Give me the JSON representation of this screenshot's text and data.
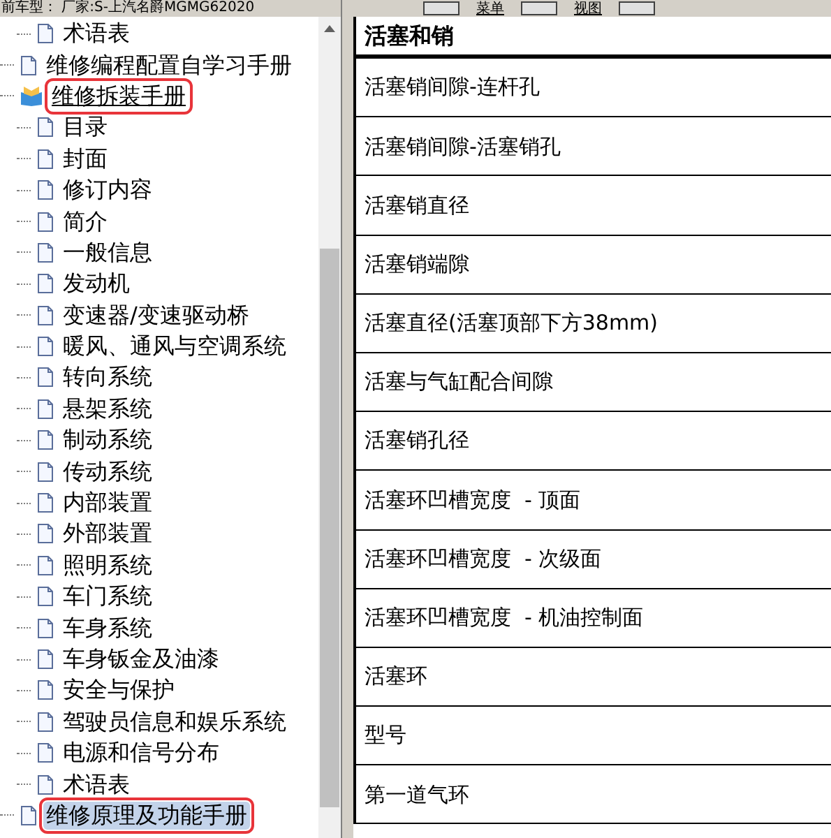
{
  "status_text": "前车型： 厂家:S-上汽名爵MGMG62020",
  "toolbar": {
    "buttons": [
      "菜单",
      "视图"
    ]
  },
  "tree": {
    "leading_items": [
      {
        "label": "术语表",
        "selected": false
      }
    ],
    "books": [
      {
        "label": "维修编程配置自学习手册",
        "expanded": false,
        "selected": false,
        "underlined": false,
        "annotated": false
      },
      {
        "label": "维修拆装手册",
        "expanded": true,
        "selected": false,
        "underlined": true,
        "annotated": true,
        "children": [
          {
            "label": "目录",
            "selected": false
          },
          {
            "label": "封面",
            "selected": false
          },
          {
            "label": "修订内容",
            "selected": false
          },
          {
            "label": "简介",
            "selected": false
          },
          {
            "label": "一般信息",
            "selected": false
          },
          {
            "label": "发动机",
            "selected": false
          },
          {
            "label": "变速器/变速驱动桥",
            "selected": false
          },
          {
            "label": "暖风、通风与空调系统",
            "selected": false
          },
          {
            "label": "转向系统",
            "selected": false
          },
          {
            "label": "悬架系统",
            "selected": false
          },
          {
            "label": "制动系统",
            "selected": false
          },
          {
            "label": "传动系统",
            "selected": false
          },
          {
            "label": "内部装置",
            "selected": false
          },
          {
            "label": "外部装置",
            "selected": false
          },
          {
            "label": "照明系统",
            "selected": false
          },
          {
            "label": "车门系统",
            "selected": false
          },
          {
            "label": "车身系统",
            "selected": false
          },
          {
            "label": "车身钣金及油漆",
            "selected": false
          },
          {
            "label": "安全与保护",
            "selected": false
          },
          {
            "label": "驾驶员信息和娱乐系统",
            "selected": false
          },
          {
            "label": "电源和信号分布",
            "selected": false
          },
          {
            "label": "术语表",
            "selected": false
          }
        ]
      },
      {
        "label": "维修原理及功能手册",
        "expanded": false,
        "selected": true,
        "underlined": false,
        "annotated": true
      }
    ]
  },
  "table": {
    "title": "活塞和销",
    "rows": [
      "活塞销间隙-连杆孔",
      "活塞销间隙-活塞销孔",
      "活塞销直径",
      "活塞销端隙",
      "活塞直径(活塞顶部下方38mm)",
      "活塞与气缸配合间隙",
      "活塞销孔径",
      "活塞环凹槽宽度  - 顶面",
      "活塞环凹槽宽度  - 次级面",
      "活塞环凹槽宽度  - 机油控制面",
      "活塞环",
      "型号",
      "第一道气环"
    ]
  }
}
